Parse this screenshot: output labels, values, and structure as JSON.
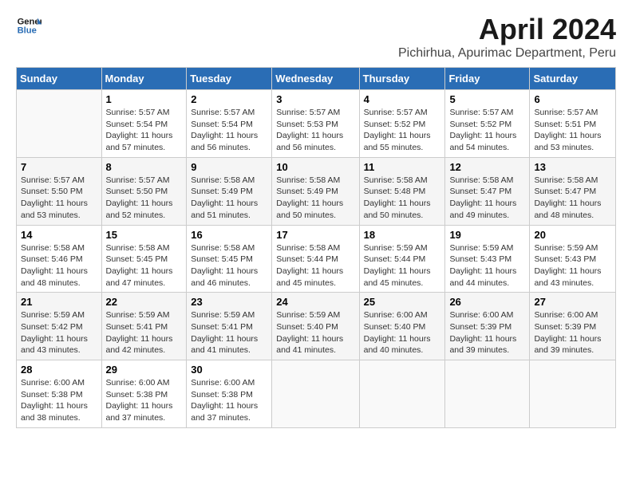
{
  "header": {
    "logo_line1": "General",
    "logo_line2": "Blue",
    "month_title": "April 2024",
    "location": "Pichirhua, Apurimac Department, Peru"
  },
  "columns": [
    "Sunday",
    "Monday",
    "Tuesday",
    "Wednesday",
    "Thursday",
    "Friday",
    "Saturday"
  ],
  "weeks": [
    [
      {
        "day": "",
        "info": ""
      },
      {
        "day": "1",
        "info": "Sunrise: 5:57 AM\nSunset: 5:54 PM\nDaylight: 11 hours\nand 57 minutes."
      },
      {
        "day": "2",
        "info": "Sunrise: 5:57 AM\nSunset: 5:54 PM\nDaylight: 11 hours\nand 56 minutes."
      },
      {
        "day": "3",
        "info": "Sunrise: 5:57 AM\nSunset: 5:53 PM\nDaylight: 11 hours\nand 56 minutes."
      },
      {
        "day": "4",
        "info": "Sunrise: 5:57 AM\nSunset: 5:52 PM\nDaylight: 11 hours\nand 55 minutes."
      },
      {
        "day": "5",
        "info": "Sunrise: 5:57 AM\nSunset: 5:52 PM\nDaylight: 11 hours\nand 54 minutes."
      },
      {
        "day": "6",
        "info": "Sunrise: 5:57 AM\nSunset: 5:51 PM\nDaylight: 11 hours\nand 53 minutes."
      }
    ],
    [
      {
        "day": "7",
        "info": "Sunrise: 5:57 AM\nSunset: 5:50 PM\nDaylight: 11 hours\nand 53 minutes."
      },
      {
        "day": "8",
        "info": "Sunrise: 5:57 AM\nSunset: 5:50 PM\nDaylight: 11 hours\nand 52 minutes."
      },
      {
        "day": "9",
        "info": "Sunrise: 5:58 AM\nSunset: 5:49 PM\nDaylight: 11 hours\nand 51 minutes."
      },
      {
        "day": "10",
        "info": "Sunrise: 5:58 AM\nSunset: 5:49 PM\nDaylight: 11 hours\nand 50 minutes."
      },
      {
        "day": "11",
        "info": "Sunrise: 5:58 AM\nSunset: 5:48 PM\nDaylight: 11 hours\nand 50 minutes."
      },
      {
        "day": "12",
        "info": "Sunrise: 5:58 AM\nSunset: 5:47 PM\nDaylight: 11 hours\nand 49 minutes."
      },
      {
        "day": "13",
        "info": "Sunrise: 5:58 AM\nSunset: 5:47 PM\nDaylight: 11 hours\nand 48 minutes."
      }
    ],
    [
      {
        "day": "14",
        "info": "Sunrise: 5:58 AM\nSunset: 5:46 PM\nDaylight: 11 hours\nand 48 minutes."
      },
      {
        "day": "15",
        "info": "Sunrise: 5:58 AM\nSunset: 5:45 PM\nDaylight: 11 hours\nand 47 minutes."
      },
      {
        "day": "16",
        "info": "Sunrise: 5:58 AM\nSunset: 5:45 PM\nDaylight: 11 hours\nand 46 minutes."
      },
      {
        "day": "17",
        "info": "Sunrise: 5:58 AM\nSunset: 5:44 PM\nDaylight: 11 hours\nand 45 minutes."
      },
      {
        "day": "18",
        "info": "Sunrise: 5:59 AM\nSunset: 5:44 PM\nDaylight: 11 hours\nand 45 minutes."
      },
      {
        "day": "19",
        "info": "Sunrise: 5:59 AM\nSunset: 5:43 PM\nDaylight: 11 hours\nand 44 minutes."
      },
      {
        "day": "20",
        "info": "Sunrise: 5:59 AM\nSunset: 5:43 PM\nDaylight: 11 hours\nand 43 minutes."
      }
    ],
    [
      {
        "day": "21",
        "info": "Sunrise: 5:59 AM\nSunset: 5:42 PM\nDaylight: 11 hours\nand 43 minutes."
      },
      {
        "day": "22",
        "info": "Sunrise: 5:59 AM\nSunset: 5:41 PM\nDaylight: 11 hours\nand 42 minutes."
      },
      {
        "day": "23",
        "info": "Sunrise: 5:59 AM\nSunset: 5:41 PM\nDaylight: 11 hours\nand 41 minutes."
      },
      {
        "day": "24",
        "info": "Sunrise: 5:59 AM\nSunset: 5:40 PM\nDaylight: 11 hours\nand 41 minutes."
      },
      {
        "day": "25",
        "info": "Sunrise: 6:00 AM\nSunset: 5:40 PM\nDaylight: 11 hours\nand 40 minutes."
      },
      {
        "day": "26",
        "info": "Sunrise: 6:00 AM\nSunset: 5:39 PM\nDaylight: 11 hours\nand 39 minutes."
      },
      {
        "day": "27",
        "info": "Sunrise: 6:00 AM\nSunset: 5:39 PM\nDaylight: 11 hours\nand 39 minutes."
      }
    ],
    [
      {
        "day": "28",
        "info": "Sunrise: 6:00 AM\nSunset: 5:38 PM\nDaylight: 11 hours\nand 38 minutes."
      },
      {
        "day": "29",
        "info": "Sunrise: 6:00 AM\nSunset: 5:38 PM\nDaylight: 11 hours\nand 37 minutes."
      },
      {
        "day": "30",
        "info": "Sunrise: 6:00 AM\nSunset: 5:38 PM\nDaylight: 11 hours\nand 37 minutes."
      },
      {
        "day": "",
        "info": ""
      },
      {
        "day": "",
        "info": ""
      },
      {
        "day": "",
        "info": ""
      },
      {
        "day": "",
        "info": ""
      }
    ]
  ]
}
